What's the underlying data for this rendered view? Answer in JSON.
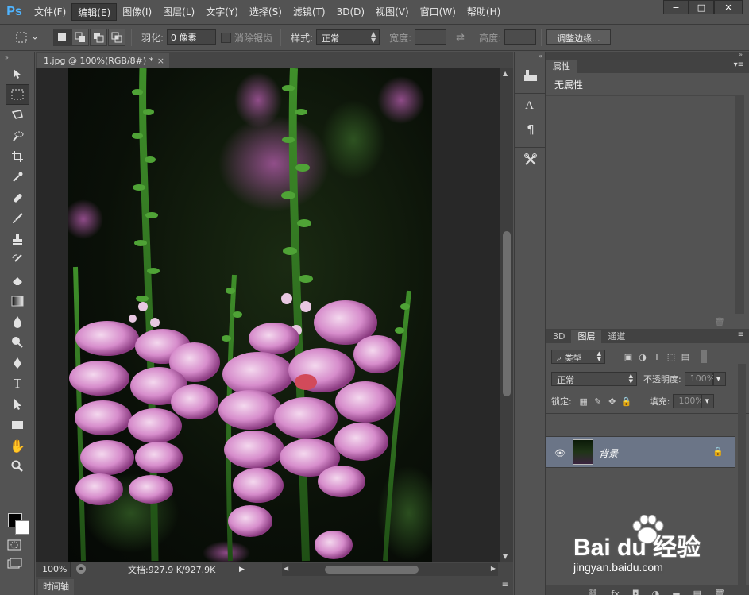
{
  "app": {
    "logo": "Ps"
  },
  "menu": [
    "文件(F)",
    "编辑(E)",
    "图像(I)",
    "图层(L)",
    "文字(Y)",
    "选择(S)",
    "滤镜(T)",
    "3D(D)",
    "视图(V)",
    "窗口(W)",
    "帮助(H)"
  ],
  "window_controls": {
    "minimize": "−",
    "maximize": "□",
    "close": "✕"
  },
  "options": {
    "feather_label": "羽化:",
    "feather_value": "0 像素",
    "antialias_label": "消除锯齿",
    "style_label": "样式:",
    "style_value": "正常",
    "width_label": "宽度:",
    "height_label": "高度:",
    "swap_icon": "⇄",
    "refine_edge": "调整边缘..."
  },
  "document": {
    "tab_title": "1.jpg @ 100%(RGB/8#) *",
    "tab_close": "×",
    "zoom": "100%",
    "doc_size": "文档:927.9 K/927.9K",
    "timeline": "时间轴"
  },
  "panels": {
    "properties": {
      "tab": "属性",
      "content": "无属性"
    },
    "layers_tabs": [
      "3D",
      "图层",
      "通道"
    ],
    "filter_kind": "类型",
    "blend_mode": "正常",
    "opacity_label": "不透明度:",
    "opacity_value": "100%",
    "lock_label": "锁定:",
    "fill_label": "填充:",
    "fill_value": "100%",
    "layer_name": "背景",
    "footer_icons": [
      "⛓",
      "fx",
      "◘",
      "◑",
      "▬",
      "▤",
      "🗑"
    ]
  },
  "watermark": {
    "brand": "Bai du 经验",
    "url": "jingyan.baidu.com"
  }
}
